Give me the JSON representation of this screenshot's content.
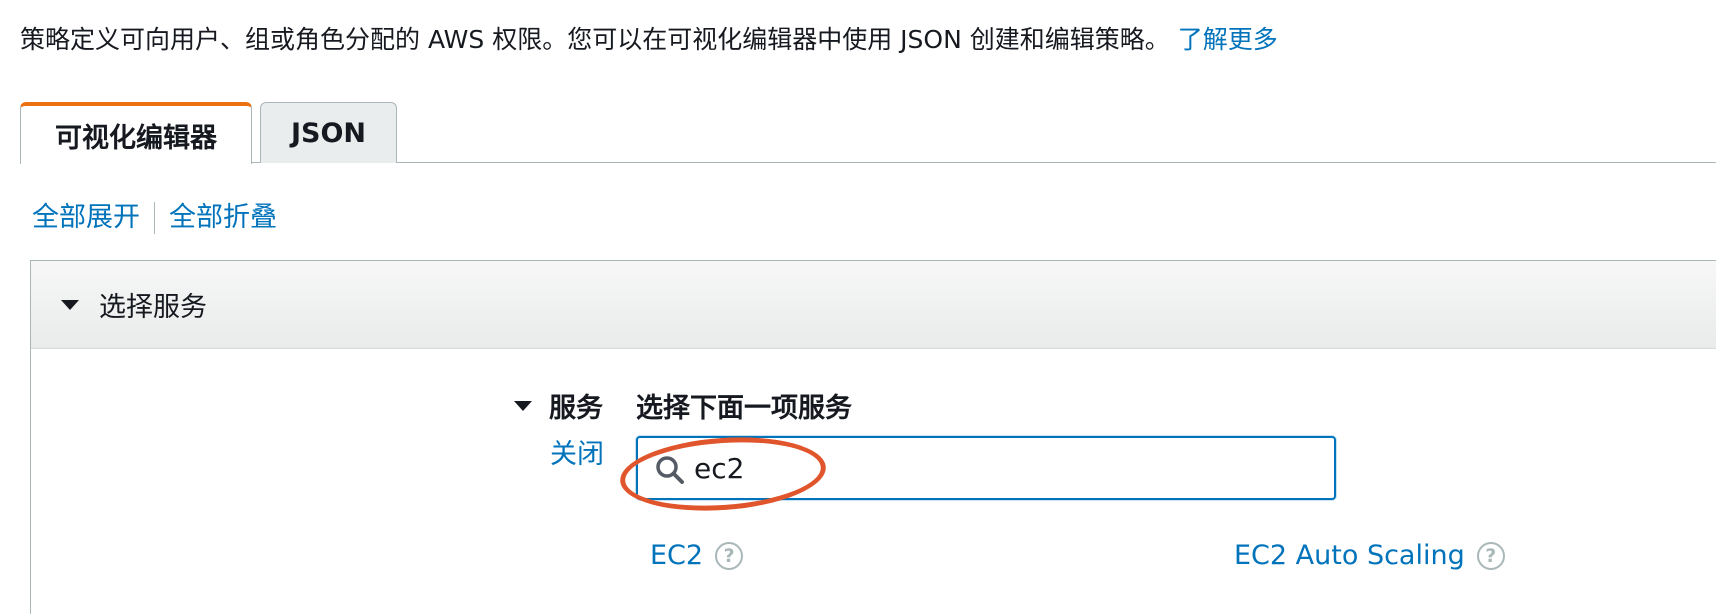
{
  "intro": {
    "text": "策略定义可向用户、组或角色分配的 AWS 权限。您可以在可视化编辑器中使用 JSON 创建和编辑策略。",
    "learn_more": "了解更多"
  },
  "tabs": [
    {
      "label": "可视化编辑器",
      "active": true
    },
    {
      "label": "JSON",
      "active": false
    }
  ],
  "expand_controls": {
    "expand_all": "全部展开",
    "collapse_all": "全部折叠"
  },
  "section": {
    "title": "选择服务",
    "service_label": "服务",
    "close_label": "关闭",
    "select_prompt": "选择下面一项服务",
    "search": {
      "value": "ec2",
      "placeholder": ""
    },
    "results": [
      {
        "label": "EC2",
        "help_glyph": "?"
      },
      {
        "label": "EC2 Auto Scaling",
        "help_glyph": "?"
      }
    ]
  },
  "colors": {
    "link": "#0073bb",
    "active_tab_accent": "#ec7211",
    "annotation": "#e0552b"
  },
  "icons": [
    "search-icon",
    "caret-down-icon",
    "help-icon"
  ]
}
